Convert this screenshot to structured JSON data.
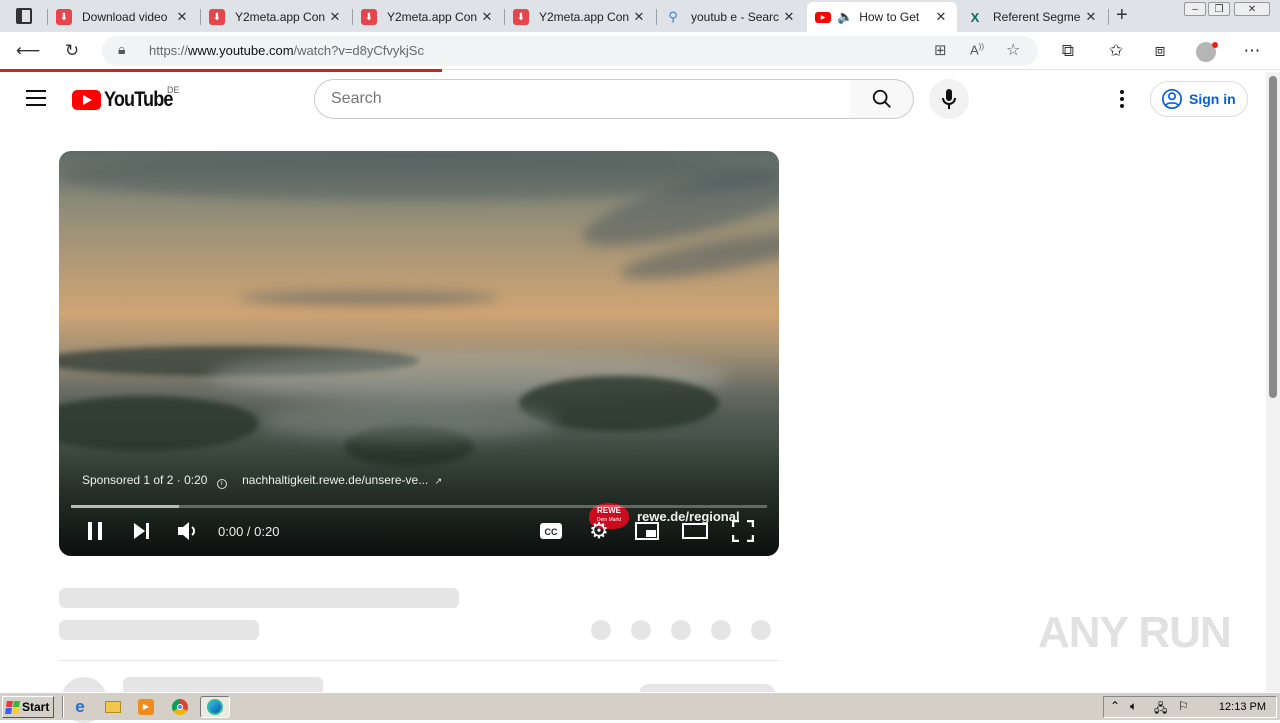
{
  "browser": {
    "tabs": [
      {
        "title": "Download video",
        "icon": "download-icon",
        "color": "#e8444c"
      },
      {
        "title": "Y2meta.app Con",
        "icon": "download-icon",
        "color": "#e8444c"
      },
      {
        "title": "Y2meta.app Con",
        "icon": "download-icon",
        "color": "#e8444c"
      },
      {
        "title": "Y2meta.app Con",
        "icon": "download-icon",
        "color": "#e8444c"
      },
      {
        "title": "youtub e - Searc",
        "icon": "search-icon",
        "color": "#3a7bd5"
      },
      {
        "title": "How to Get",
        "icon": "youtube-icon",
        "color": "#ff0000",
        "active": true,
        "audio": true
      },
      {
        "title": "Referent Segme",
        "icon": "xing-icon",
        "color": "#0a6b67"
      }
    ],
    "url": {
      "prefix": "https://",
      "host": "www.youtube.com",
      "path": "/watch?v=d8yCfvykjSc"
    },
    "load_progress": 0.345
  },
  "youtube": {
    "logo_text": "YouTube",
    "country": "DE",
    "search_placeholder": "Search",
    "signin_label": "Sign in"
  },
  "player": {
    "ad_label": "Sponsored 1 of 2 · 0:20",
    "ad_link": "nachhaltigkeit.rewe.de/unsere-ve...",
    "time": "0:00 / 0:20",
    "progress": 0,
    "overlay_badge": "REWE",
    "overlay_badge_sub": "Dein Markt",
    "overlay_site": "rewe.de/regional"
  },
  "watermark": "ANY RUN",
  "taskbar": {
    "start_label": "Start",
    "clock": "12:13 PM"
  },
  "colors": {
    "youtube_red": "#ff0000",
    "link_blue": "#065fd4",
    "progress_yellow": "#ffcc00"
  }
}
